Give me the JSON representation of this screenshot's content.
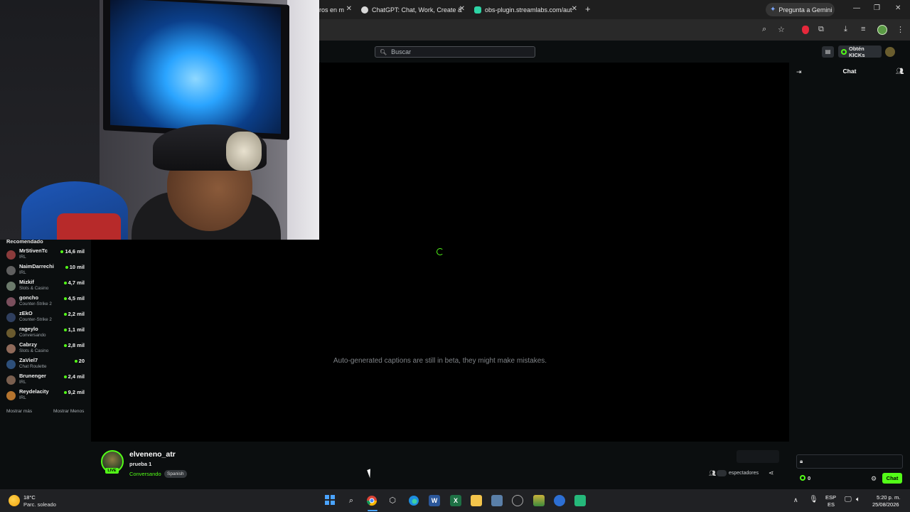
{
  "browser": {
    "tabs": [
      {
        "title": "ros en m",
        "favicon": "blank-icon"
      },
      {
        "title": "ChatGPT: Chat, Work, Create &",
        "favicon": "openai-icon"
      },
      {
        "title": "obs-plugin.streamlabs.com/aut",
        "favicon": "streamlabs-icon"
      }
    ],
    "gemini_label": "Pregunta a Gemini"
  },
  "site": {
    "search_placeholder": "Buscar",
    "kicks_label": "Obtén KICKs",
    "accent_color": "#53fc18"
  },
  "sidebar": {
    "title": "Recomendado",
    "channels": [
      {
        "name": "MrStivenTc",
        "category": "IRL",
        "viewers": "14,6 mil",
        "avatar_color": "#8a3b3b"
      },
      {
        "name": "NaimDarrechi",
        "category": "IRL",
        "viewers": "10 mil",
        "avatar_color": "#5f5f5f"
      },
      {
        "name": "Mizkif",
        "category": "Slots & Casino",
        "viewers": "4,7 mil",
        "avatar_color": "#6b7a6b"
      },
      {
        "name": "goncho",
        "category": "Counter-Strike 2",
        "viewers": "4,5 mil",
        "avatar_color": "#7a4f5d"
      },
      {
        "name": "zEkO",
        "category": "Counter-Strike 2",
        "viewers": "2,2 mil",
        "avatar_color": "#2f3f5f"
      },
      {
        "name": "rageylo",
        "category": "Conversando",
        "viewers": "1,1 mil",
        "avatar_color": "#6a5a2e"
      },
      {
        "name": "Cabrzy",
        "category": "Slots & Casino",
        "viewers": "2,8 mil",
        "avatar_color": "#8f6a5a"
      },
      {
        "name": "ZaViel7",
        "category": "Chat Roulette",
        "viewers": "20",
        "avatar_color": "#2d4f7a"
      },
      {
        "name": "Brunenger",
        "category": "IRL",
        "viewers": "2,4 mil",
        "avatar_color": "#7a5f4f"
      },
      {
        "name": "Reydelacity",
        "category": "IRL",
        "viewers": "9,2 mil",
        "avatar_color": "#b5742e"
      }
    ],
    "show_more": "Mostrar más",
    "show_less": "Mostrar Menos"
  },
  "player": {
    "caption_notice": "Auto-generated captions are still in beta, they might make mistakes."
  },
  "stream": {
    "channel_name": "elveneno_atr",
    "title": "prueba 1",
    "category": "Conversando",
    "language": "Spanish",
    "live_badge": "LIVE",
    "viewers_label": "espectadores"
  },
  "chat": {
    "title": "Chat",
    "points": "0",
    "send_label": "Chat"
  },
  "taskbar": {
    "weather_temp": "18°C",
    "weather_desc": "Parc. soleado",
    "lang_line1": "ESP",
    "lang_line2": "ES",
    "time": "5:20 p. m.",
    "date": "25/08/2026"
  }
}
